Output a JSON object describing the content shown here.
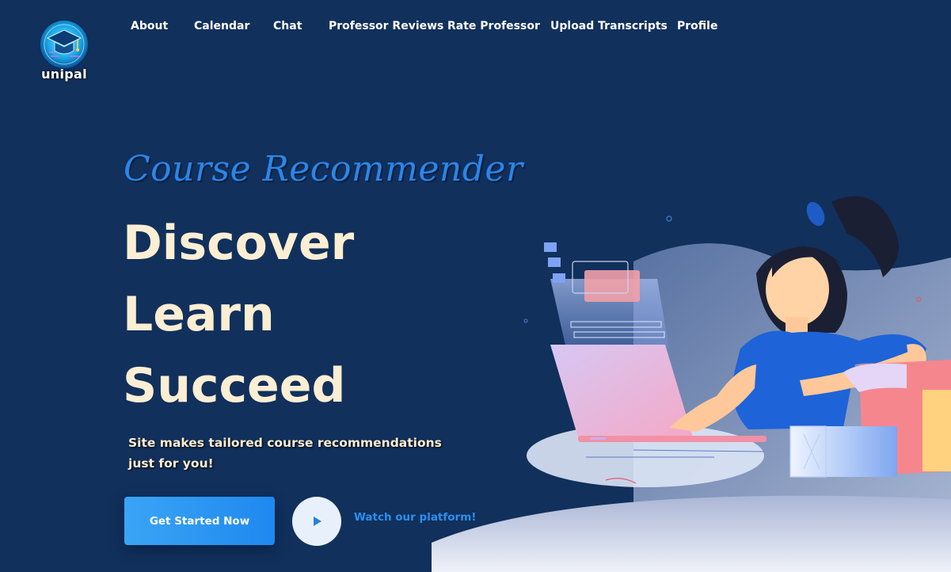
{
  "brand": {
    "name": "unipal"
  },
  "nav": {
    "items": [
      {
        "label": "About"
      },
      {
        "label": "Calendar"
      },
      {
        "label": "Chat"
      },
      {
        "label": "Professor Reviews"
      },
      {
        "label": "Rate Professor"
      },
      {
        "label": "Upload Transcripts"
      },
      {
        "label": "Profile"
      }
    ]
  },
  "hero": {
    "subtitle": "Course Recommender",
    "headlines": [
      "Discover",
      "Learn",
      "Succeed"
    ],
    "tagline": "Site makes tailored course recommendations just for you!",
    "cta_label": "Get Started Now",
    "watch_label": "Watch our platform!"
  },
  "icons": {
    "logo": "graduation-cap-logo-icon",
    "play": "play-icon",
    "illustration": "woman-at-laptop-illustration"
  },
  "colors": {
    "background": "#11305c",
    "accent": "#2b8ff0",
    "headline": "#fbeed3",
    "nav_text": "#ffffff"
  }
}
